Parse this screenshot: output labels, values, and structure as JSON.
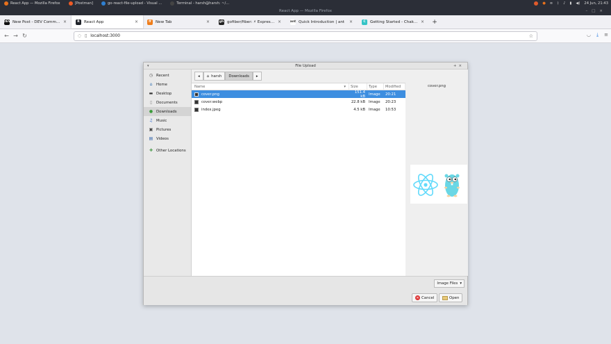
{
  "system": {
    "activities": [
      {
        "label": "React App — Mozilla Firefox",
        "color": "#e8711c"
      },
      {
        "label": "[Postman]",
        "color": "#ef5b25"
      },
      {
        "label": "go-react-file-upload - Visual ...",
        "color": "#2f80d1"
      },
      {
        "label": "Terminal - harsh@harsh: ~/...",
        "color": "#444"
      }
    ],
    "clock": "24 Jun, 21:43"
  },
  "window": {
    "title": "React App — Mozilla Firefox"
  },
  "browser": {
    "tabs": [
      {
        "label": "New Post - DEV Community",
        "icon": "DEV",
        "color": "#111",
        "active": false
      },
      {
        "label": "React App",
        "icon": "R",
        "color": "#20232a",
        "active": true
      },
      {
        "label": "New Tab",
        "icon": "ff",
        "color": "#ef7d1a",
        "active": false
      },
      {
        "label": "gofiber/fiber: ⚡ Express insp",
        "icon": "gh",
        "color": "#222",
        "active": false
      },
      {
        "label": "Quick Introduction | ant",
        "icon": "ant",
        "color": "#fff",
        "active": false
      },
      {
        "label": "Getting Started - Chakra UI",
        "icon": "C",
        "color": "#35c4c6",
        "active": false
      }
    ],
    "url": "localhost:3000"
  },
  "dialog": {
    "title": "File Upload",
    "places": [
      {
        "label": "Recent",
        "icon": "clock-icon",
        "glyph": "◷"
      },
      {
        "label": "Home",
        "icon": "home-icon",
        "glyph": "⌂"
      },
      {
        "label": "Desktop",
        "icon": "desktop-icon",
        "glyph": "▬"
      },
      {
        "label": "Documents",
        "icon": "document-icon",
        "glyph": "▯"
      },
      {
        "label": "Downloads",
        "icon": "download-icon",
        "glyph": "●"
      },
      {
        "label": "Music",
        "icon": "music-icon",
        "glyph": "♫"
      },
      {
        "label": "Pictures",
        "icon": "picture-icon",
        "glyph": "▣"
      },
      {
        "label": "Videos",
        "icon": "video-icon",
        "glyph": "▤"
      },
      {
        "label": "Other Locations",
        "icon": "plus-icon",
        "glyph": "✚"
      }
    ],
    "path": {
      "home": "harsh",
      "current": "Downloads"
    },
    "columns": {
      "name": "Name",
      "size": "Size",
      "type": "Type",
      "modified": "Modified"
    },
    "files": [
      {
        "name": "cover.png",
        "size": "151.4 kB",
        "type": "Image",
        "modified": "20:21",
        "selected": true
      },
      {
        "name": "cover.webp",
        "size": "22.8 kB",
        "type": "Image",
        "modified": "20:23",
        "selected": false
      },
      {
        "name": "index.jpeg",
        "size": "4.5 kB",
        "type": "Image",
        "modified": "10:53",
        "selected": false
      }
    ],
    "preview_name": "cover.png",
    "filter": "Image Files",
    "cancel": "Cancel",
    "open": "Open"
  }
}
